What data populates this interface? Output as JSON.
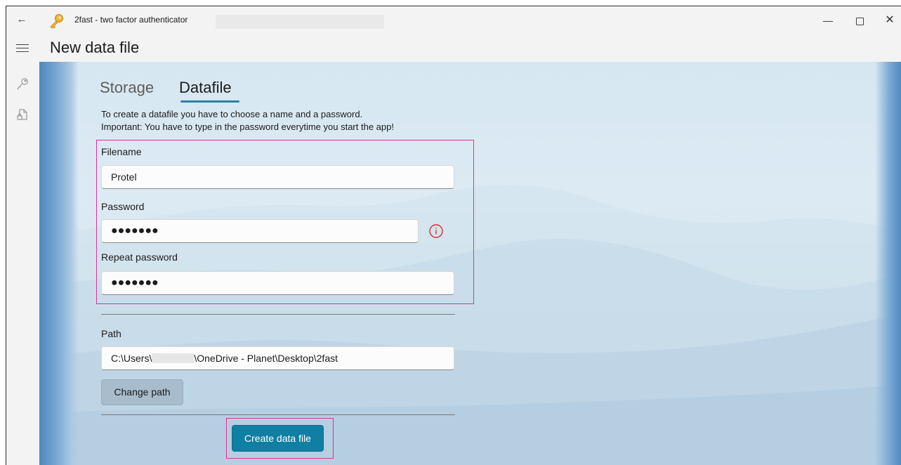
{
  "window": {
    "title": "2fast - two factor authenticator",
    "back_icon": "back-arrow-icon",
    "app_icon": "key-icon",
    "controls": {
      "minimize": "minimize-icon",
      "maximize": "maximize-icon",
      "close": "close-icon"
    }
  },
  "header": {
    "page_title": "New data file",
    "menu_icon": "hamburger-icon"
  },
  "rail": {
    "items": [
      "key-icon",
      "lock-file-icon"
    ]
  },
  "tabs": [
    {
      "label": "Storage",
      "active": false
    },
    {
      "label": "Datafile",
      "active": true
    }
  ],
  "description": {
    "line1": "To create a datafile you have to choose a name and a password.",
    "line2": "Important: You have to type in the password everytime you start the app!"
  },
  "form": {
    "filename_label": "Filename",
    "filename_value": "Protel",
    "password_label": "Password",
    "password_value": "●●●●●●●",
    "password_info_icon": "info-circle-icon",
    "repeat_label": "Repeat password",
    "repeat_value": "●●●●●●●",
    "path_label": "Path",
    "path_prefix": "C:\\Users\\",
    "path_suffix": "\\OneDrive - Planet\\Desktop\\2fast",
    "change_path_label": "Change path",
    "create_label": "Create data file"
  },
  "colors": {
    "accent": "#0f7fa3",
    "highlight": "#e0329a",
    "info": "#d32f2f",
    "secondary_button": "#a8bccb"
  }
}
